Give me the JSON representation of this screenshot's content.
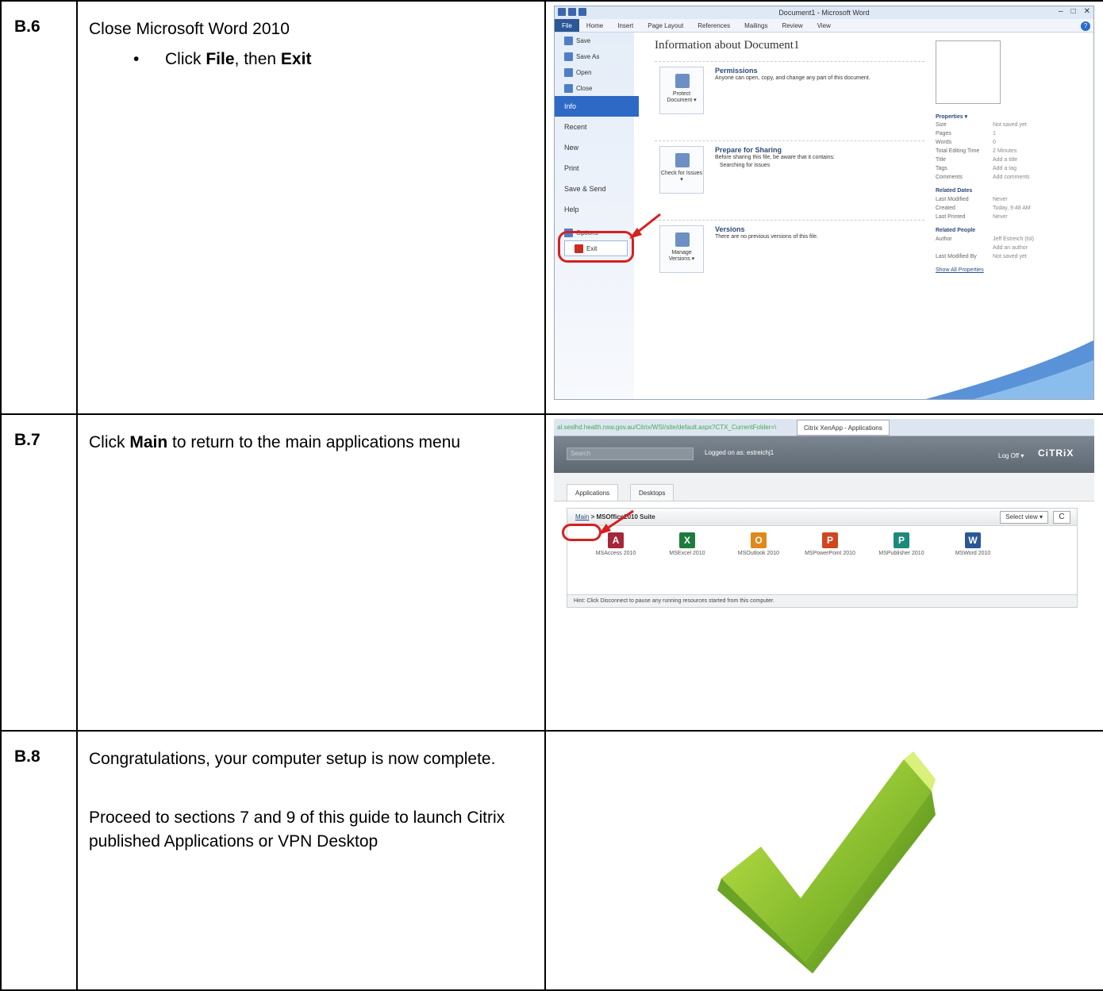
{
  "rows": [
    {
      "step": "B.6",
      "text": "Close Microsoft Word 2010",
      "bullet": {
        "pre": "Click ",
        "b1": "File",
        "mid": ", then ",
        "b2": "Exit"
      }
    },
    {
      "step": "B.7",
      "pre": "Click ",
      "bold": "Main",
      "post": " to return to the main applications menu"
    },
    {
      "step": "B.8",
      "p1": "Congratulations, your computer setup is now complete.",
      "p2": "Proceed to sections 7 and 9 of this guide to launch Citrix published Applications or VPN Desktop"
    }
  ],
  "word": {
    "title": "Document1 - Microsoft Word",
    "ribbon_tabs": [
      "File",
      "Home",
      "Insert",
      "Page Layout",
      "References",
      "Mailings",
      "Review",
      "View"
    ],
    "side_small": [
      "Save",
      "Save As",
      "Open",
      "Close"
    ],
    "side_big": [
      "Info",
      "Recent",
      "New",
      "Print",
      "Save & Send",
      "Help"
    ],
    "options": "Options",
    "exit": "Exit",
    "heading": "Information about Document1",
    "sections": [
      {
        "button": "Protect Document ▾",
        "title": "Permissions",
        "desc": "Anyone can open, copy, and change any part of this document."
      },
      {
        "button": "Check for Issues ▾",
        "title": "Prepare for Sharing",
        "desc": "Before sharing this file, be aware that it contains:",
        "sub": "Searching for issues"
      },
      {
        "button": "Manage Versions ▾",
        "title": "Versions",
        "desc": "There are no previous versions of this file."
      }
    ],
    "props_heading": "Properties ▾",
    "props": [
      [
        "Size",
        "Not saved yet"
      ],
      [
        "Pages",
        "1"
      ],
      [
        "Words",
        "0"
      ],
      [
        "Total Editing Time",
        "2 Minutes"
      ],
      [
        "Title",
        "Add a title"
      ],
      [
        "Tags",
        "Add a tag"
      ],
      [
        "Comments",
        "Add comments"
      ]
    ],
    "dates_heading": "Related Dates",
    "dates": [
      [
        "Last Modified",
        "Never"
      ],
      [
        "Created",
        "Today, 9:48 AM"
      ],
      [
        "Last Printed",
        "Never"
      ]
    ],
    "people_heading": "Related People",
    "people": [
      [
        "Author",
        "Jeff Estreich (tsl)"
      ],
      [
        "",
        "Add an author"
      ],
      [
        "Last Modified By",
        "Not saved yet"
      ]
    ],
    "show_all": "Show All Properties"
  },
  "citrix": {
    "url": "al.seslhd.health.nsw.gov.au/Citrix/WSI/site/default.aspx?CTX_CurrentFolder=\\",
    "tab": "Citrix XenApp - Applications",
    "search": "Search",
    "logged": "Logged on as: estreichj1",
    "logoff": "Log Off ▾",
    "brand": "CiTRiX",
    "tabs": [
      "Applications",
      "Desktops"
    ],
    "breadcrumb_main": "Main",
    "breadcrumb_rest": " > MSOffice2010 Suite",
    "select_view": "Select view ▾",
    "refresh": "C",
    "apps": [
      {
        "name": "MSAccess 2010",
        "color": "#a4273a",
        "letter": "A"
      },
      {
        "name": "MSExcel 2010",
        "color": "#1f7a3e",
        "letter": "X"
      },
      {
        "name": "MSOutlook 2010",
        "color": "#e0881a",
        "letter": "O"
      },
      {
        "name": "MSPowerPoint 2010",
        "color": "#d0461f",
        "letter": "P"
      },
      {
        "name": "MSPublisher 2010",
        "color": "#1c8a7a",
        "letter": "P"
      },
      {
        "name": "MSWord 2010",
        "color": "#2b5797",
        "letter": "W"
      }
    ],
    "hint": "Hint: Click Disconnect to pause any running resources started from this computer."
  }
}
